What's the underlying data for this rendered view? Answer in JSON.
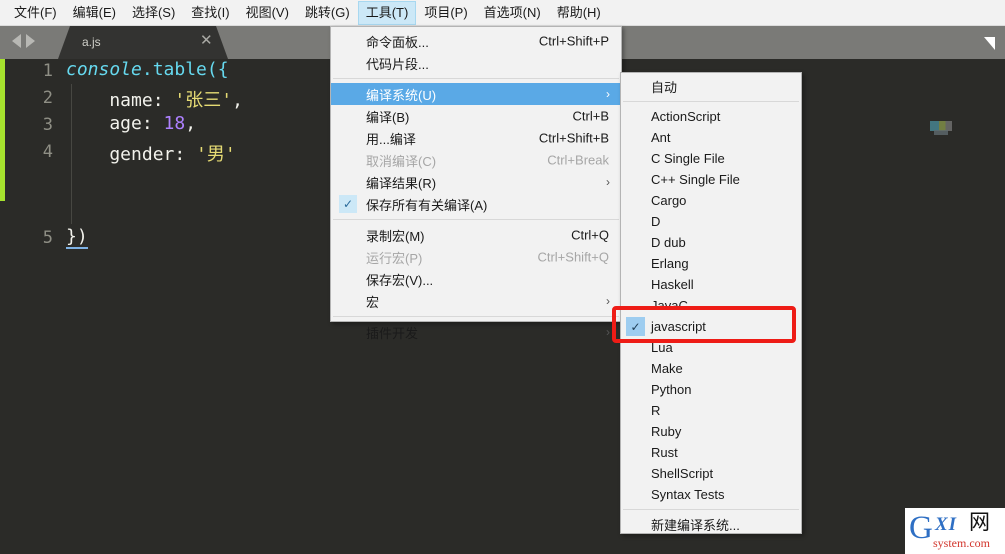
{
  "menubar": {
    "items": [
      {
        "label": "文件(F)",
        "active": false
      },
      {
        "label": "编辑(E)",
        "active": false
      },
      {
        "label": "选择(S)",
        "active": false
      },
      {
        "label": "查找(I)",
        "active": false
      },
      {
        "label": "视图(V)",
        "active": false
      },
      {
        "label": "跳转(G)",
        "active": false
      },
      {
        "label": "工具(T)",
        "active": true
      },
      {
        "label": "项目(P)",
        "active": false
      },
      {
        "label": "首选项(N)",
        "active": false
      },
      {
        "label": "帮助(H)",
        "active": false
      }
    ]
  },
  "tabbar": {
    "tab_label": "a.js",
    "close_glyph": "✕"
  },
  "editor": {
    "line_numbers": [
      "1",
      "2",
      "3",
      "4",
      "5"
    ],
    "code": {
      "l1_console": "console",
      "l1_dot_table": ".table({",
      "l2_key": "    name: ",
      "l2_val": "'张三'",
      "l2_comma": ",",
      "l3_key": "    age: ",
      "l3_val": "18",
      "l3_comma": ",",
      "l4_key": "    gender: ",
      "l4_val": "'男'",
      "l5": "})"
    }
  },
  "dropdown": {
    "items": [
      {
        "label": "命令面板...",
        "accel": "Ctrl+Shift+P",
        "type": "item"
      },
      {
        "label": "代码片段...",
        "accel": "",
        "type": "item"
      },
      {
        "type": "separator"
      },
      {
        "label": "编译系统(U)",
        "accel": "",
        "type": "submenu",
        "highlighted": true,
        "chevron": "›"
      },
      {
        "label": "编译(B)",
        "accel": "Ctrl+B",
        "type": "item"
      },
      {
        "label": "用...编译",
        "accel": "Ctrl+Shift+B",
        "type": "item"
      },
      {
        "label": "取消编译(C)",
        "accel": "Ctrl+Break",
        "type": "item",
        "disabled": true
      },
      {
        "label": "编译结果(R)",
        "accel": "",
        "type": "submenu",
        "chevron": "›"
      },
      {
        "label": "保存所有有关编译(A)",
        "accel": "",
        "type": "item",
        "checked": true,
        "check_glyph": "✓"
      },
      {
        "type": "separator"
      },
      {
        "label": "录制宏(M)",
        "accel": "Ctrl+Q",
        "type": "item"
      },
      {
        "label": "运行宏(P)",
        "accel": "Ctrl+Shift+Q",
        "type": "item",
        "disabled": true
      },
      {
        "label": "保存宏(V)...",
        "accel": "",
        "type": "item"
      },
      {
        "label": "宏",
        "accel": "",
        "type": "submenu",
        "chevron": "›"
      },
      {
        "type": "separator"
      },
      {
        "label": "插件开发",
        "accel": "",
        "type": "submenu",
        "chevron": "›"
      }
    ]
  },
  "submenu": {
    "items": [
      {
        "label": "自动",
        "type": "item"
      },
      {
        "type": "separator"
      },
      {
        "label": "ActionScript",
        "type": "item"
      },
      {
        "label": "Ant",
        "type": "item"
      },
      {
        "label": "C Single File",
        "type": "item"
      },
      {
        "label": "C++ Single File",
        "type": "item"
      },
      {
        "label": "Cargo",
        "type": "item"
      },
      {
        "label": "D",
        "type": "item"
      },
      {
        "label": "D dub",
        "type": "item"
      },
      {
        "label": "Erlang",
        "type": "item"
      },
      {
        "label": "Haskell",
        "type": "item"
      },
      {
        "label": "JavaC",
        "type": "item"
      },
      {
        "label": "javascript",
        "type": "item",
        "checked": true,
        "check_glyph": "✓"
      },
      {
        "label": "Lua",
        "type": "item"
      },
      {
        "label": "Make",
        "type": "item"
      },
      {
        "label": "Python",
        "type": "item"
      },
      {
        "label": "R",
        "type": "item"
      },
      {
        "label": "Ruby",
        "type": "item"
      },
      {
        "label": "Rust",
        "type": "item"
      },
      {
        "label": "ShellScript",
        "type": "item"
      },
      {
        "label": "Syntax Tests",
        "type": "item"
      },
      {
        "type": "separator"
      },
      {
        "label": "新建编译系统...",
        "type": "item"
      }
    ]
  },
  "annotation": {
    "color": "#ee1c16",
    "target_label": "javascript"
  },
  "watermark": {
    "g": "G",
    "xi": "XI",
    "cn": "网",
    "sub": "system.com"
  }
}
